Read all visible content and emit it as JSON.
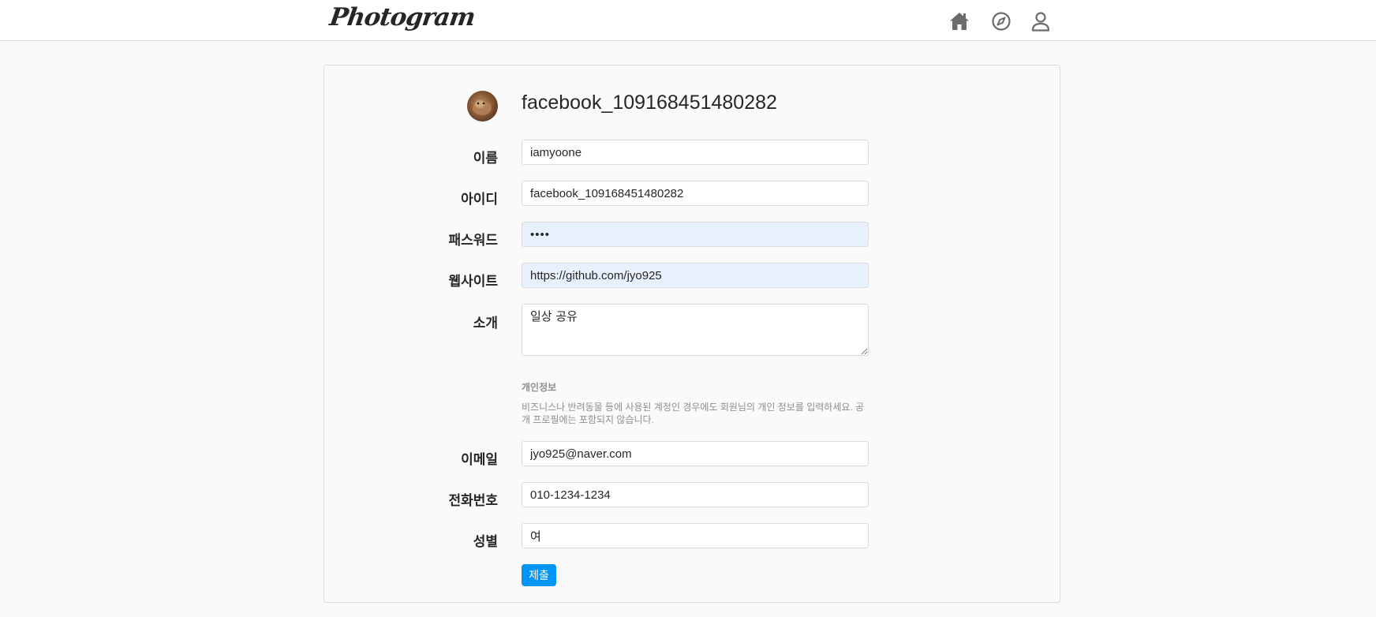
{
  "app": {
    "logo": "Photogram"
  },
  "nav": {
    "icons": [
      "home-icon",
      "explore-icon",
      "profile-icon"
    ]
  },
  "profile": {
    "username": "facebook_109168451480282"
  },
  "form": {
    "name_label": "이름",
    "name_value": "iamyoone",
    "id_label": "아이디",
    "id_value": "facebook_109168451480282",
    "password_label": "패스워드",
    "password_value": "••••",
    "website_label": "웹사이트",
    "website_value": "https://github.com/jyo925",
    "bio_label": "소개",
    "bio_value": "일상 공유",
    "private_title": "개인정보",
    "private_desc": "비즈니스나 반려동물 등에 사용된 계정인 경우에도 회원님의 개인 정보를 입력하세요. 공개 프로필에는 포함되지 않습니다.",
    "email_label": "이메일",
    "email_value": "jyo925@naver.com",
    "phone_label": "전화번호",
    "phone_value": "010-1234-1234",
    "gender_label": "성별",
    "gender_value": "여",
    "submit_label": "제출"
  },
  "colors": {
    "accent": "#0095f6",
    "border": "#dbdbdb",
    "autofill": "#e8f0fe",
    "background": "#fafafa"
  }
}
